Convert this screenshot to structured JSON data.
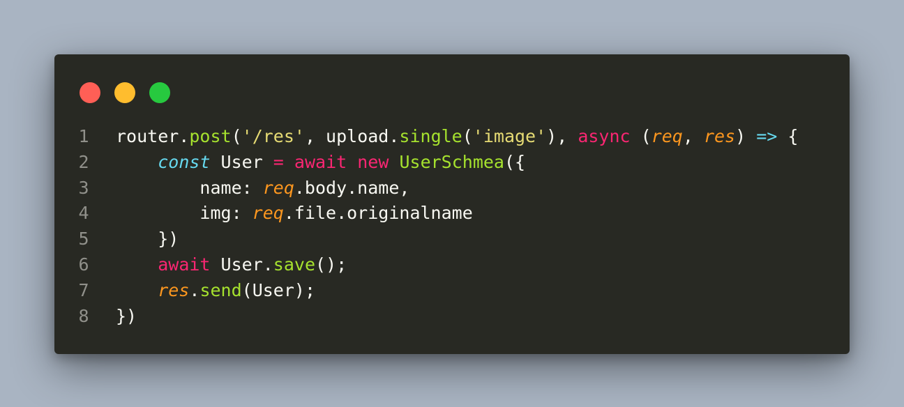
{
  "window": {
    "dots": [
      {
        "name": "close-dot",
        "color": "#ff5f56"
      },
      {
        "name": "minimize-dot",
        "color": "#ffbd2e"
      },
      {
        "name": "zoom-dot",
        "color": "#27c93f"
      }
    ]
  },
  "code": {
    "lines": [
      {
        "num": "1",
        "tokens": [
          {
            "t": "router.",
            "c": "plain"
          },
          {
            "t": "post",
            "c": "func"
          },
          {
            "t": "(",
            "c": "plain"
          },
          {
            "t": "'/res'",
            "c": "str"
          },
          {
            "t": ", upload.",
            "c": "plain"
          },
          {
            "t": "single",
            "c": "func"
          },
          {
            "t": "(",
            "c": "plain"
          },
          {
            "t": "'image'",
            "c": "str"
          },
          {
            "t": "), ",
            "c": "plain"
          },
          {
            "t": "async",
            "c": "kw"
          },
          {
            "t": " (",
            "c": "plain"
          },
          {
            "t": "req",
            "c": "param"
          },
          {
            "t": ", ",
            "c": "plain"
          },
          {
            "t": "res",
            "c": "param"
          },
          {
            "t": ") ",
            "c": "plain"
          },
          {
            "t": "=>",
            "c": "arrow"
          },
          {
            "t": " {",
            "c": "plain"
          }
        ]
      },
      {
        "num": "2",
        "tokens": [
          {
            "t": "    ",
            "c": "plain"
          },
          {
            "t": "const",
            "c": "storage"
          },
          {
            "t": " User ",
            "c": "plain"
          },
          {
            "t": "=",
            "c": "kw"
          },
          {
            "t": " ",
            "c": "plain"
          },
          {
            "t": "await",
            "c": "kw"
          },
          {
            "t": " ",
            "c": "plain"
          },
          {
            "t": "new",
            "c": "kw"
          },
          {
            "t": " ",
            "c": "plain"
          },
          {
            "t": "UserSchmea",
            "c": "func"
          },
          {
            "t": "({",
            "c": "plain"
          }
        ]
      },
      {
        "num": "3",
        "tokens": [
          {
            "t": "        name: ",
            "c": "plain"
          },
          {
            "t": "req",
            "c": "param"
          },
          {
            "t": ".body.name,",
            "c": "plain"
          }
        ]
      },
      {
        "num": "4",
        "tokens": [
          {
            "t": "        img: ",
            "c": "plain"
          },
          {
            "t": "req",
            "c": "param"
          },
          {
            "t": ".file.originalname",
            "c": "plain"
          }
        ]
      },
      {
        "num": "5",
        "tokens": [
          {
            "t": "    })",
            "c": "plain"
          }
        ]
      },
      {
        "num": "6",
        "tokens": [
          {
            "t": "    ",
            "c": "plain"
          },
          {
            "t": "await",
            "c": "kw"
          },
          {
            "t": " User.",
            "c": "plain"
          },
          {
            "t": "save",
            "c": "func"
          },
          {
            "t": "();",
            "c": "plain"
          }
        ]
      },
      {
        "num": "7",
        "tokens": [
          {
            "t": "    ",
            "c": "plain"
          },
          {
            "t": "res",
            "c": "param"
          },
          {
            "t": ".",
            "c": "plain"
          },
          {
            "t": "send",
            "c": "func"
          },
          {
            "t": "(User);",
            "c": "plain"
          }
        ]
      },
      {
        "num": "8",
        "tokens": [
          {
            "t": "})",
            "c": "plain"
          }
        ]
      }
    ]
  }
}
